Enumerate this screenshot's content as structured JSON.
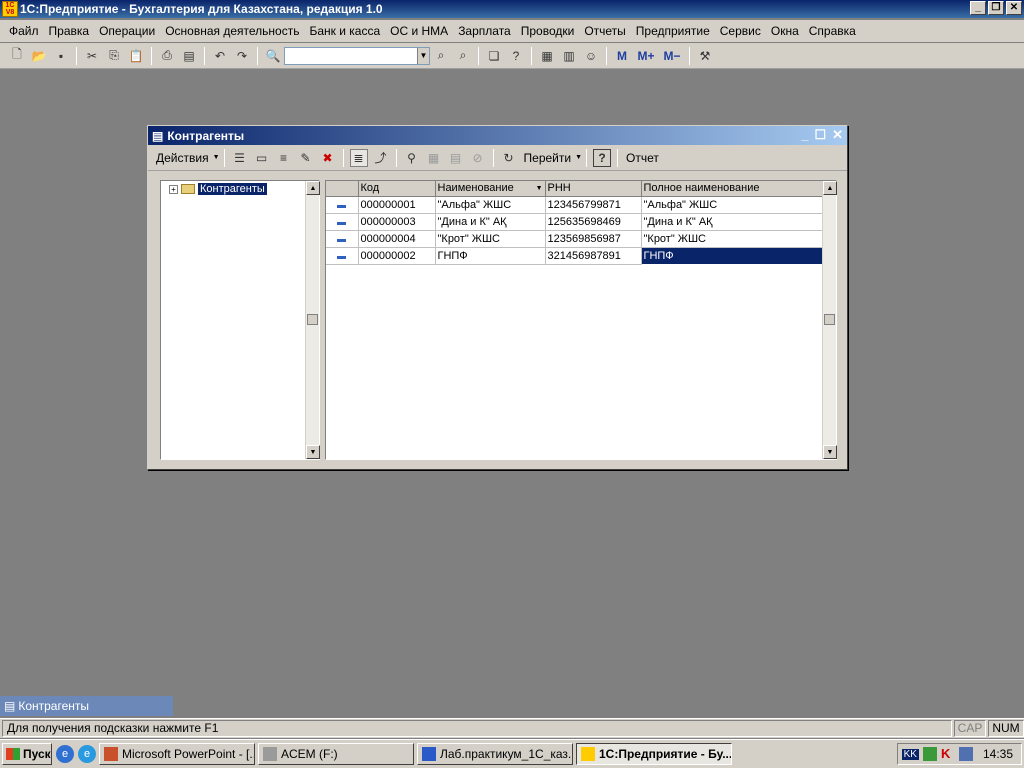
{
  "app": {
    "title": "1С:Предприятие - Бухгалтерия для Казахстана, редакция 1.0",
    "icon_text": "1C V8"
  },
  "menu": [
    "Файл",
    "Правка",
    "Операции",
    "Основная деятельность",
    "Банк и касса",
    "ОС и НМА",
    "Зарплата",
    "Проводки",
    "Отчеты",
    "Предприятие",
    "Сервис",
    "Окна",
    "Справка"
  ],
  "toolbar_icons": [
    "new-doc-icon",
    "open-icon",
    "save-icon",
    "cut-icon",
    "copy-icon",
    "paste-icon",
    "print-icon",
    "preview-icon",
    "undo-icon",
    "redo-icon",
    "find-icon"
  ],
  "dialog": {
    "title": "Контрагенты",
    "actions_label": "Действия",
    "goto_label": "Перейти",
    "report_label": "Отчет",
    "help_label": "?"
  },
  "tree": {
    "root_label": "Контрагенты"
  },
  "table": {
    "columns": [
      "Код",
      "Наименование",
      "РНН",
      "Полное наименование"
    ],
    "rows": [
      {
        "code": "000000001",
        "name": "\"Альфа\" ЖШС",
        "rnn": "123456799871",
        "full": "\"Альфа\" ЖШС"
      },
      {
        "code": "000000003",
        "name": "\"Дина и К\" АҚ",
        "rnn": "125635698469",
        "full": "\"Дина и К\" АҚ"
      },
      {
        "code": "000000004",
        "name": "\"Крот\" ЖШС",
        "rnn": "123569856987",
        "full": "\"Крот\" ЖШС"
      },
      {
        "code": "000000002",
        "name": "ГНПФ",
        "rnn": "321456987891",
        "full": "ГНПФ"
      }
    ]
  },
  "mdi_tab": "Контрагенты",
  "status": {
    "hint": "Для получения подсказки нажмите F1",
    "cap": "CAP",
    "num": "NUM"
  },
  "taskbar": {
    "start": "Пуск",
    "tasks": [
      "Microsoft PowerPoint - [...",
      "ACEM (F:)",
      "Лаб.практикум_1С_каз...",
      "1С:Предприятие - Бу..."
    ],
    "lang": "KK",
    "clock": "14:35"
  },
  "colors": {
    "selection": "#0a246a",
    "window_bg": "#d4d0c8",
    "desktop": "#808080"
  }
}
